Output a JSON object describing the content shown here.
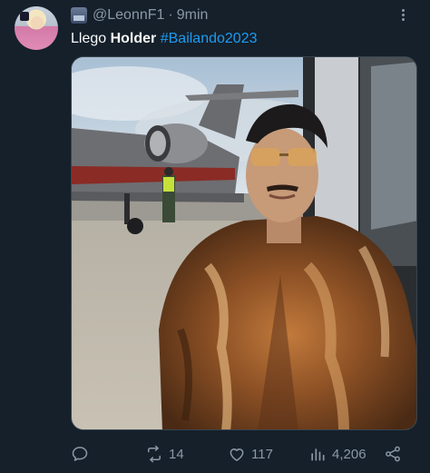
{
  "tweet": {
    "author_handle": "@LeonnF1",
    "separator": "·",
    "time": "9min",
    "text_prefix": "Llego ",
    "text_bold": "Holder",
    "text_space": " ",
    "hashtag": "#Bailando2023",
    "media_icon": "photo-man-fur-coat-jet"
  },
  "actions": {
    "reply_count": "",
    "retweet_count": "14",
    "like_count": "117",
    "views_count": "4,206"
  },
  "icons": {
    "reply": "reply-icon",
    "retweet": "retweet-icon",
    "like": "heart-icon",
    "views": "views-icon",
    "share": "share-icon",
    "more": "more-icon"
  },
  "colors": {
    "background": "#15202b",
    "text": "#f7f9f9",
    "secondary": "#8b98a5",
    "link": "#1d9bf0"
  }
}
